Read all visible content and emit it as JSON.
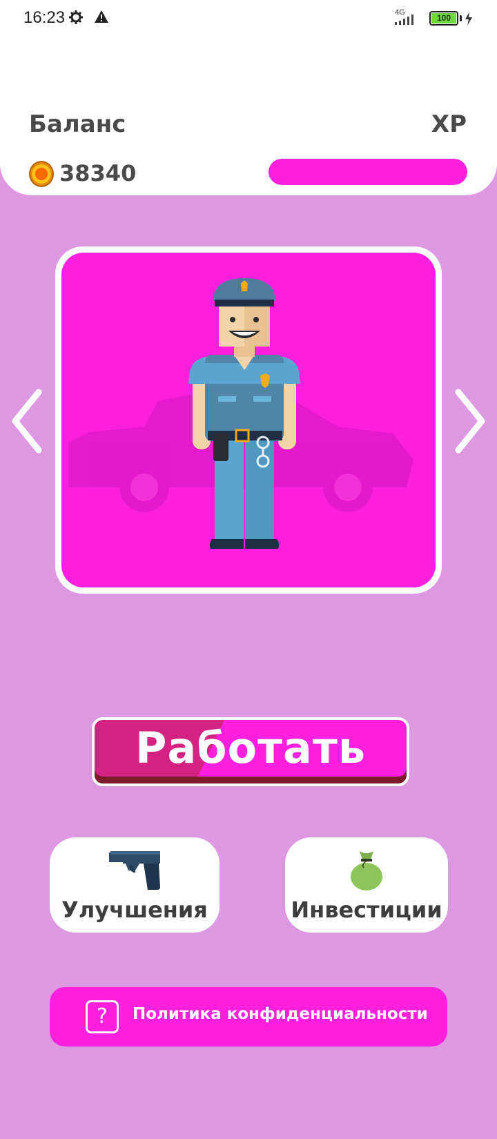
{
  "status_bar": {
    "time": "16:23",
    "network": "4G",
    "battery": "100",
    "icons": [
      "settings-gear-icon",
      "warning-icon",
      "signal-icon",
      "battery-icon",
      "charging-icon"
    ]
  },
  "header": {
    "balance_label": "Баланс",
    "balance_value": "38340",
    "xp_label": "XP",
    "xp_progress": 1.0
  },
  "character_card": {
    "character": "police-officer",
    "background": "car",
    "prev_icon": "chevron-left-icon",
    "next_icon": "chevron-right-icon"
  },
  "actions": {
    "work_label": "Работать",
    "upgrades_label": "Улучшения",
    "upgrades_icon": "pistol-icon",
    "investments_label": "Инвестиции",
    "investments_icon": "money-bag-icon",
    "privacy_label": "Политика конфиденциальности",
    "privacy_icon_glyph": "?"
  },
  "colors": {
    "background": "#dc98e0",
    "accent": "#ff1fdc",
    "work_button_dark": "#d42282"
  }
}
